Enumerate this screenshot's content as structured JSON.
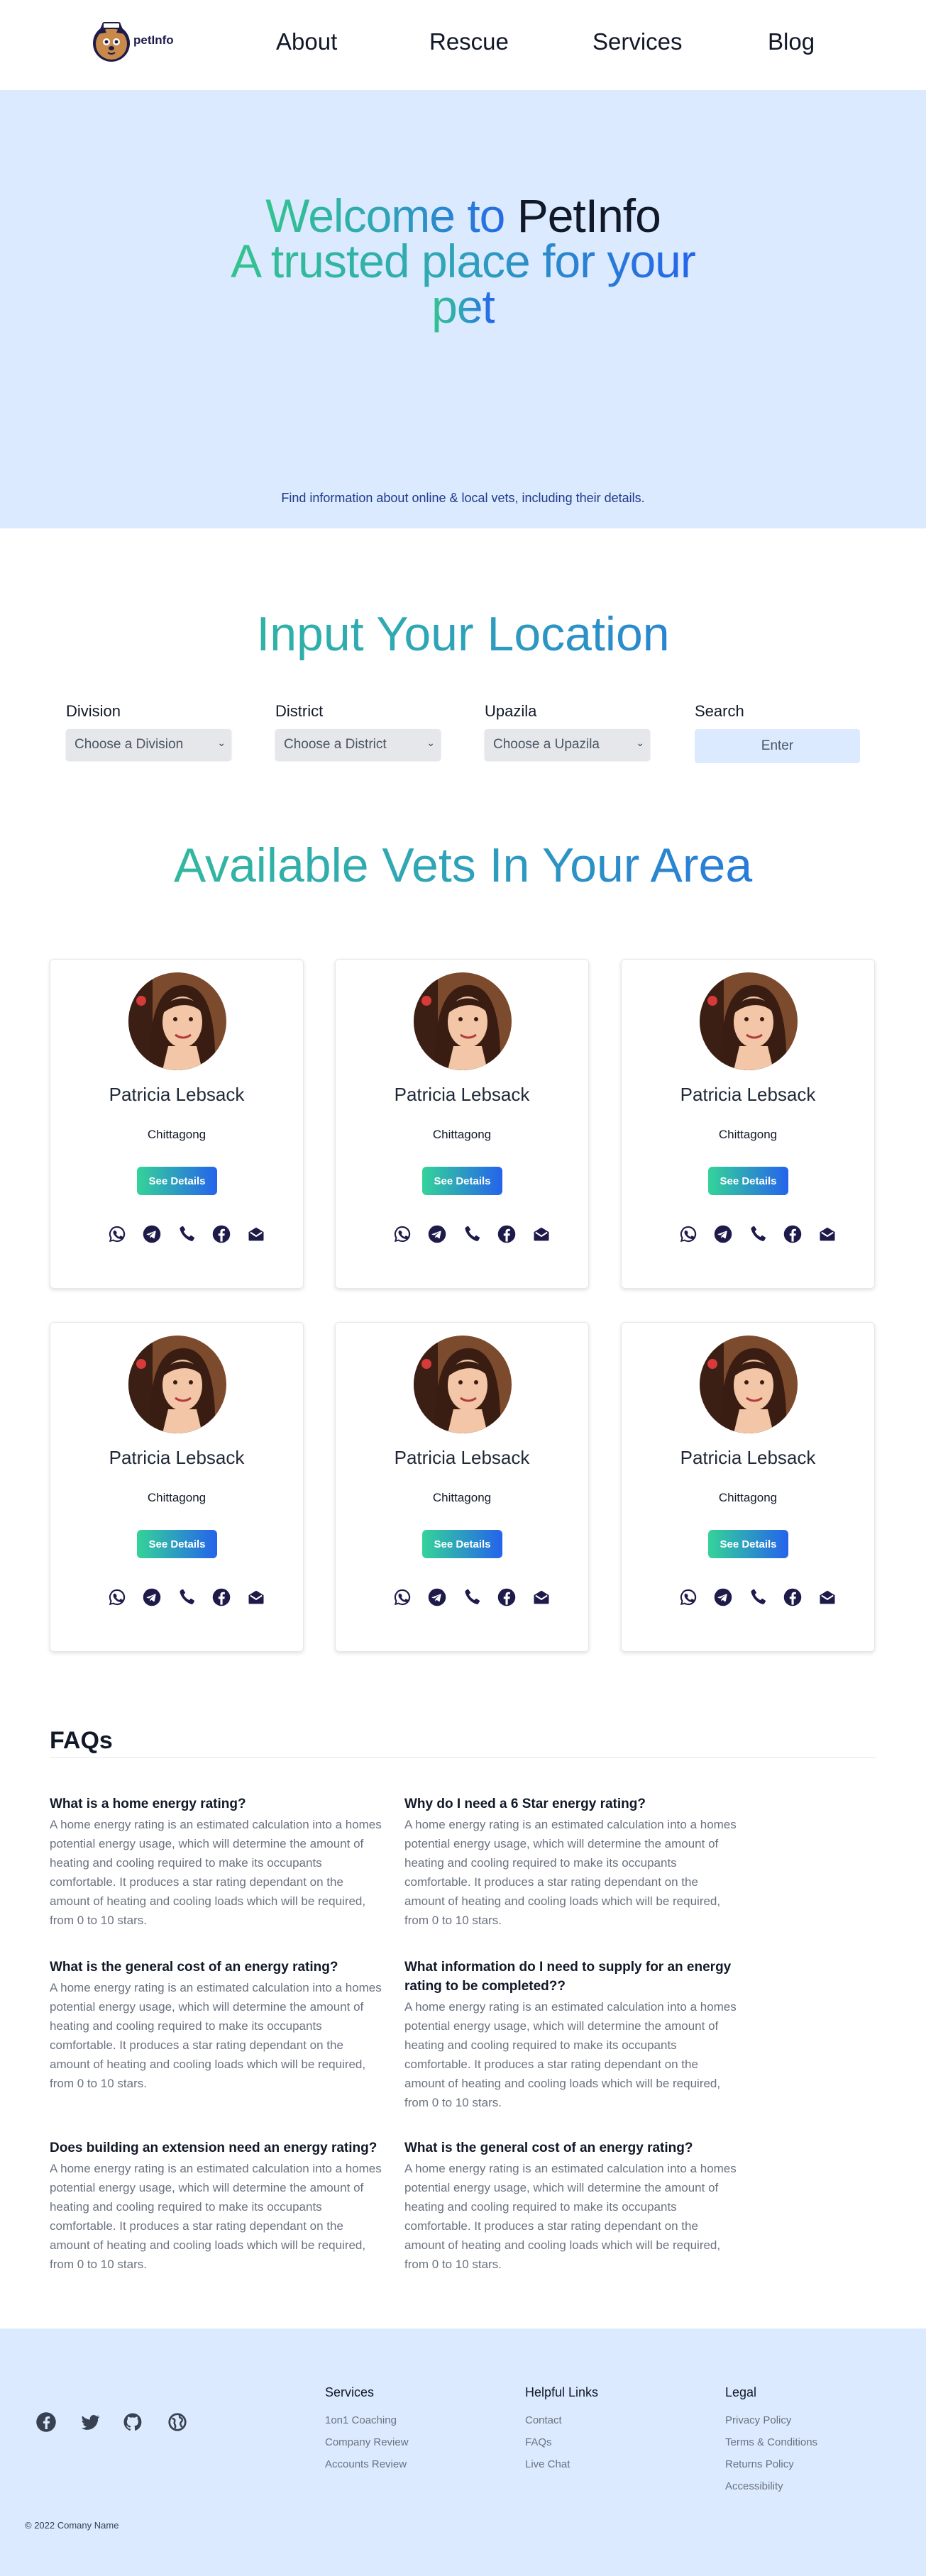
{
  "nav": {
    "logo_text": "petInfo",
    "links": [
      "About",
      "Rescue",
      "Services",
      "Blog"
    ]
  },
  "hero": {
    "line1_welcome": "Welcome to ",
    "line1_brand": "PetInfo",
    "line2": "A trusted place for your",
    "line3": "pet",
    "subtitle": "Find information about online & local vets, including their details."
  },
  "location": {
    "title": "Input Your Location",
    "division_label": "Division",
    "division_value": "Choose a Division",
    "district_label": "District",
    "district_value": "Choose a District",
    "upazila_label": "Upazila",
    "upazila_value": "Choose a Upazila",
    "search_label": "Search",
    "search_button": "Enter"
  },
  "vets": {
    "title": "Available Vets In Your Area",
    "details_label": "See Details",
    "items": [
      {
        "name": "Patricia Lebsack",
        "location": "Chittagong"
      },
      {
        "name": "Patricia Lebsack",
        "location": "Chittagong"
      },
      {
        "name": "Patricia Lebsack",
        "location": "Chittagong"
      },
      {
        "name": "Patricia Lebsack",
        "location": "Chittagong"
      },
      {
        "name": "Patricia Lebsack",
        "location": "Chittagong"
      },
      {
        "name": "Patricia Lebsack",
        "location": "Chittagong"
      }
    ],
    "social_icons": [
      "whatsapp-icon",
      "telegram-icon",
      "phone-icon",
      "facebook-icon",
      "email-icon"
    ]
  },
  "faq": {
    "title": "FAQs",
    "items": [
      {
        "q": "What is a home energy rating?",
        "a": "A home energy rating is an estimated calculation into a homes potential energy usage, which will determine the amount of heating and cooling required to make its occupants comfortable. It produces a star rating dependant on the amount of heating and cooling loads which will be required, from 0 to 10 stars."
      },
      {
        "q": "Why do I need a 6 Star energy rating?",
        "a": "A home energy rating is an estimated calculation into a homes potential energy usage, which will determine the amount of heating and cooling required to make its occupants comfortable. It produces a star rating dependant on the amount of heating and cooling loads which will be required, from 0 to 10 stars."
      },
      {
        "q": "What is the general cost of an energy rating?",
        "a": "A home energy rating is an estimated calculation into a homes potential energy usage, which will determine the amount of heating and cooling required to make its occupants comfortable. It produces a star rating dependant on the amount of heating and cooling loads which will be required, from 0 to 10 stars."
      },
      {
        "q": "What information do I need to supply for an energy rating to be completed??",
        "a": "A home energy rating is an estimated calculation into a homes potential energy usage, which will determine the amount of heating and cooling required to make its occupants comfortable. It produces a star rating dependant on the amount of heating and cooling loads which will be required, from 0 to 10 stars."
      },
      {
        "q": "Does building an extension need an energy rating?",
        "a": "A home energy rating is an estimated calculation into a homes potential energy usage, which will determine the amount of heating and cooling required to make its occupants comfortable. It produces a star rating dependant on the amount of heating and cooling loads which will be required, from 0 to 10 stars."
      },
      {
        "q": "What is the general cost of an energy rating?",
        "a": "A home energy rating is an estimated calculation into a homes potential energy usage, which will determine the amount of heating and cooling required to make its occupants comfortable. It produces a star rating dependant on the amount of heating and cooling loads which will be required, from 0 to 10 stars."
      }
    ]
  },
  "footer": {
    "social_icons": [
      "facebook-icon",
      "twitter-icon",
      "github-icon",
      "globe-icon"
    ],
    "columns": [
      {
        "title": "Services",
        "links": [
          "1on1 Coaching",
          "Company Review",
          "Accounts Review"
        ]
      },
      {
        "title": "Helpful Links",
        "links": [
          "Contact",
          "FAQs",
          "Live Chat"
        ]
      },
      {
        "title": "Legal",
        "links": [
          "Privacy Policy",
          "Terms & Conditions",
          "Returns Policy",
          "Accessibility"
        ]
      }
    ],
    "copyright": "© 2022 Comany Name"
  },
  "colors": {
    "accent_green": "#34d399",
    "accent_blue": "#2563eb",
    "hero_bg": "#dbeafe",
    "icon_navy": "#1e1b4b"
  }
}
